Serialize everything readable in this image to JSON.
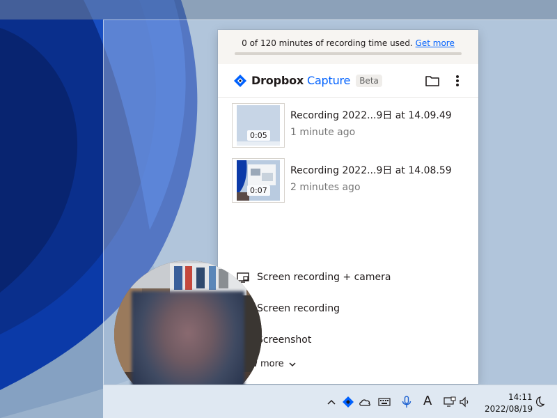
{
  "usage": {
    "text": "0 of 120 minutes of recording time used.",
    "link": "Get more",
    "used_minutes": 0,
    "total_minutes": 120
  },
  "header": {
    "brand": "Dropbox",
    "product": "Capture",
    "badge": "Beta"
  },
  "recordings": [
    {
      "title": "Recording 2022...9日 at 14.09.49",
      "time": "1 minute ago",
      "duration": "0:05"
    },
    {
      "title": "Recording 2022...9日 at 14.08.59",
      "time": "2 minutes ago",
      "duration": "0:07"
    }
  ],
  "actions": [
    {
      "label": "Screen recording + camera",
      "icon": "screen-camera-icon"
    },
    {
      "label": "Screen recording",
      "icon": "screen-record-icon"
    },
    {
      "label": "Screenshot",
      "icon": "screenshot-icon"
    }
  ],
  "view_more": "View more",
  "taskbar": {
    "time": "14:11",
    "date": "2022/08/19",
    "ime_label": "A"
  },
  "colors": {
    "accent": "#0061fe",
    "text": "#1e1919",
    "muted": "#767676",
    "banner_bg": "#f7f5f2"
  }
}
